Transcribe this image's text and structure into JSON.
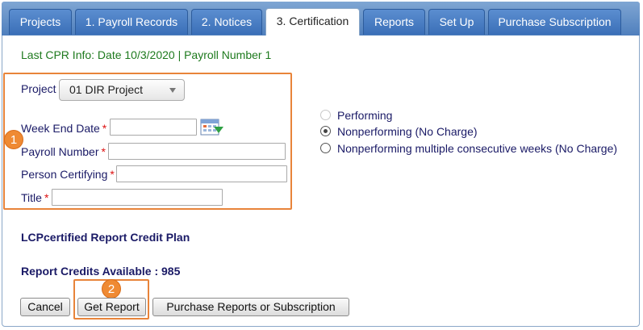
{
  "tabs": [
    {
      "label": "Projects",
      "active": false
    },
    {
      "label": "1. Payroll Records",
      "active": false
    },
    {
      "label": "2. Notices",
      "active": false
    },
    {
      "label": "3. Certification",
      "active": true
    },
    {
      "label": "Reports",
      "active": false
    },
    {
      "label": "Set Up",
      "active": false
    },
    {
      "label": "Purchase Subscription",
      "active": false
    }
  ],
  "info_line": "Last CPR Info: Date 10/3/2020 | Payroll Number 1",
  "form": {
    "project_label": "Project",
    "project_value": "01 DIR Project",
    "week_end_label": "Week End Date",
    "payroll_number_label": "Payroll Number",
    "person_certifying_label": "Person Certifying",
    "title_label": "Title",
    "required_mark": "*",
    "week_end_value": "",
    "payroll_number_value": "",
    "person_certifying_value": "",
    "title_value": ""
  },
  "radios": [
    {
      "label": "Performing",
      "checked": false,
      "disabled": true
    },
    {
      "label": "Nonperforming (No Charge)",
      "checked": true,
      "disabled": false
    },
    {
      "label": "Nonperforming multiple consecutive weeks (No Charge)",
      "checked": false,
      "disabled": false
    }
  ],
  "credit_plan": "LCPcertified Report Credit Plan",
  "credits_available": "Report Credits Available : 985",
  "buttons": {
    "cancel": "Cancel",
    "get_report": "Get Report",
    "purchase": "Purchase Reports or Subscription"
  },
  "callouts": {
    "one": "1",
    "two": "2"
  },
  "colors": {
    "accent": "#e8843a",
    "tab": "#3a6fb7",
    "info": "#1e7a1e",
    "text": "#1a1a66"
  }
}
